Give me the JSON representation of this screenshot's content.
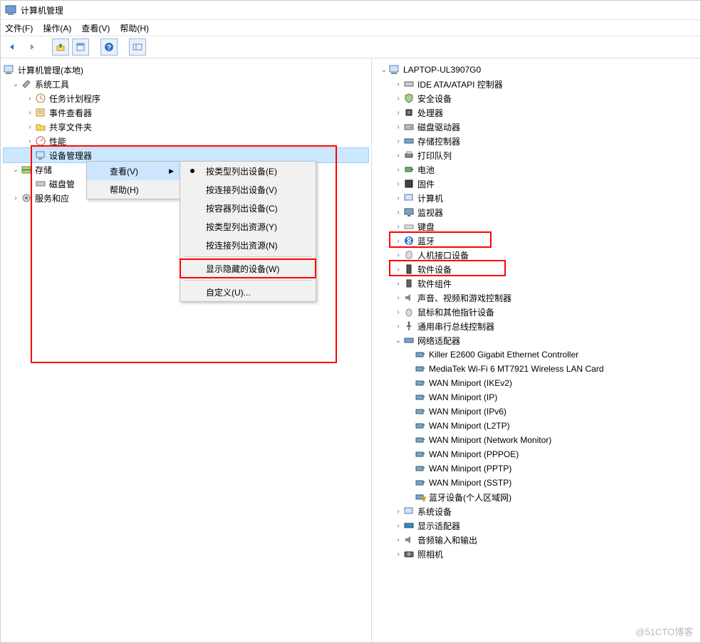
{
  "title": "计算机管理",
  "menubar": {
    "file": "文件(F)",
    "action": "操作(A)",
    "view": "查看(V)",
    "help": "帮助(H)"
  },
  "left_tree": {
    "root": "计算机管理(本地)",
    "sys_tools": "系统工具",
    "task_sched": "任务计划程序",
    "event_viewer": "事件查看器",
    "shared_folders": "共享文件夹",
    "perf": "性能",
    "device_mgr": "设备管理器",
    "storage": "存储",
    "disk_mgmt": "磁盘管",
    "services": "服务和应"
  },
  "context": {
    "view": "查看(V)",
    "help": "帮助(H)"
  },
  "submenu": {
    "by_type": "按类型列出设备(E)",
    "by_conn": "按连接列出设备(V)",
    "by_container": "按容器列出设备(C)",
    "res_by_type": "按类型列出资源(Y)",
    "res_by_conn": "按连接列出资源(N)",
    "show_hidden": "显示隐藏的设备(W)",
    "custom": "自定义(U)..."
  },
  "right_tree": {
    "root": "LAPTOP-UL3907G0",
    "ide": "IDE ATA/ATAPI 控制器",
    "security": "安全设备",
    "cpu": "处理器",
    "disk": "磁盘驱动器",
    "storage_ctrl": "存储控制器",
    "print_queue": "打印队列",
    "battery": "电池",
    "firmware": "固件",
    "computer": "计算机",
    "monitor": "监视器",
    "keyboard": "键盘",
    "bluetooth": "蓝牙",
    "hid": "人机接口设备",
    "soft_dev": "软件设备",
    "soft_comp": "软件组件",
    "audio_video": "声音、视频和游戏控制器",
    "mouse": "鼠标和其他指针设备",
    "usb": "通用串行总线控制器",
    "net_adapters": "网络适配器",
    "net": {
      "killer": "Killer E2600 Gigabit Ethernet Controller",
      "mediatek": "MediaTek Wi-Fi 6 MT7921 Wireless LAN Card",
      "ikev2": "WAN Miniport (IKEv2)",
      "ip": "WAN Miniport (IP)",
      "ipv6": "WAN Miniport (IPv6)",
      "l2tp": "WAN Miniport (L2TP)",
      "monitor": "WAN Miniport (Network Monitor)",
      "pppoe": "WAN Miniport (PPPOE)",
      "pptp": "WAN Miniport (PPTP)",
      "sstp": "WAN Miniport (SSTP)",
      "bt_pan": "蓝牙设备(个人区域网)"
    },
    "sys_dev": "系统设备",
    "display": "显示适配器",
    "audio_io": "音频输入和输出",
    "camera": "照相机"
  },
  "watermark": "@51CTO博客"
}
